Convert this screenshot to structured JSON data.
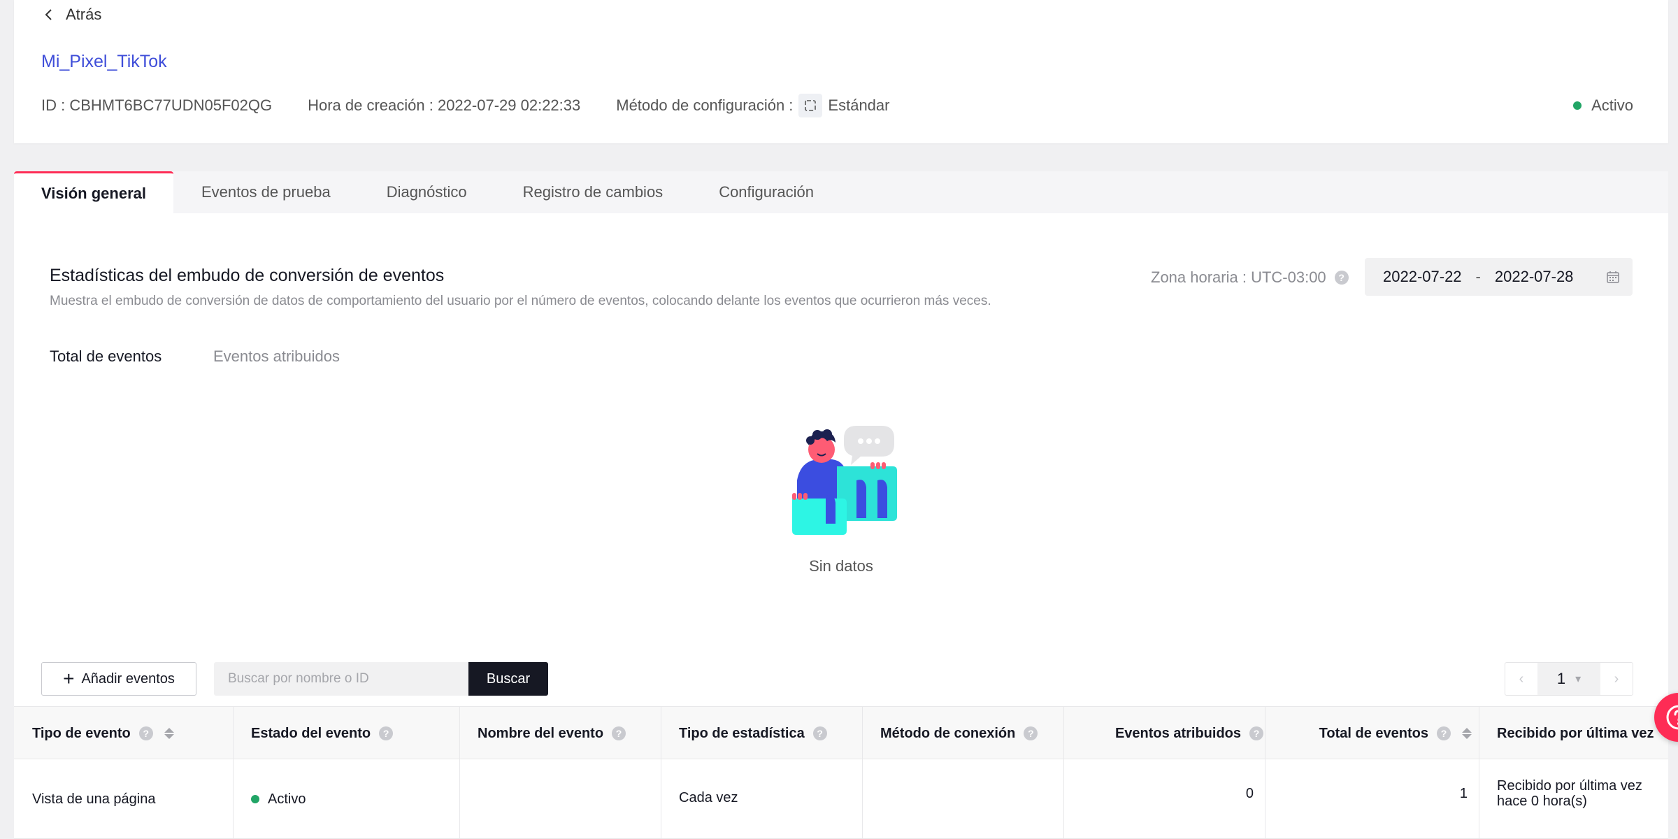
{
  "header": {
    "back_label": "Atrás",
    "pixel_name": "Mi_Pixel_TikTok",
    "id_text": "ID : CBHMT6BC77UDN05F02QG",
    "created_text": "Hora de creación : 2022-07-29 02:22:33",
    "config_label": "Método de configuración :",
    "config_value": "Estándar",
    "status": "Activo"
  },
  "tabs": [
    {
      "label": "Visión general"
    },
    {
      "label": "Eventos de prueba"
    },
    {
      "label": "Diagnóstico"
    },
    {
      "label": "Registro de cambios"
    },
    {
      "label": "Configuración"
    }
  ],
  "funnel": {
    "title": "Estadísticas del embudo de conversión de eventos",
    "description": "Muestra el embudo de conversión de datos de comportamiento del usuario por el número de eventos, colocando delante los eventos que ocurrieron más veces.",
    "timezone": "Zona horaria : UTC-03:00",
    "date_start": "2022-07-22",
    "date_sep": "-",
    "date_end": "2022-07-28",
    "subtabs": [
      "Total de eventos",
      "Eventos atribuidos"
    ],
    "empty_text": "Sin datos"
  },
  "toolbar": {
    "add_label": "Añadir eventos",
    "search_placeholder": "Buscar por nombre o ID",
    "search_label": "Buscar",
    "page": "1"
  },
  "table": {
    "headers": {
      "event_type": "Tipo de evento",
      "event_status": "Estado del evento",
      "event_name": "Nombre del evento",
      "stat_type": "Tipo de estadística",
      "connection": "Método de conexión",
      "attributed": "Eventos atribuidos",
      "total": "Total de eventos",
      "last_received": "Recibido por última vez"
    },
    "rows": [
      {
        "event_type": "Vista de una página",
        "event_status": "Activo",
        "event_name": "",
        "stat_type": "Cada vez",
        "connection": "",
        "attributed": "0",
        "total": "1",
        "last_received_1": "Recibido por última vez",
        "last_received_2": "hace 0 hora(s)"
      }
    ]
  },
  "colors": {
    "accent": "#fe2c55",
    "link": "#3f4ed9",
    "status_active": "#21a566",
    "dark_button": "#161823"
  },
  "help_icon": "?",
  "icons": [
    "chevron-left-icon",
    "config-standard-icon",
    "calendar-icon",
    "help-icon",
    "plus-icon",
    "sort-icon",
    "support-icon"
  ]
}
